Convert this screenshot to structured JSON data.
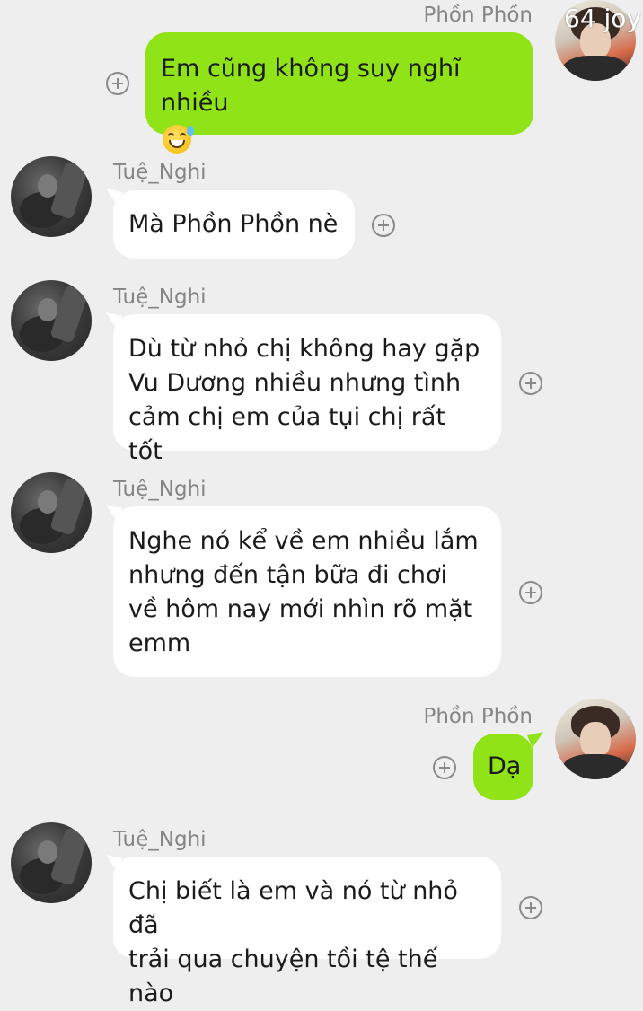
{
  "watermark": "64 joy",
  "messages": [
    {
      "sender": "Phồn Phồn",
      "direction": "outgoing",
      "text": "Em cũng không suy nghĩ nhiều",
      "emoji": "grinning-sweat-emoji"
    },
    {
      "sender": "Tuệ_Nghi",
      "direction": "incoming",
      "text": "Mà Phồn Phồn nè"
    },
    {
      "sender": "Tuệ_Nghi",
      "direction": "incoming",
      "text": "Dù từ nhỏ chị không hay gặp\nVu Dương nhiều nhưng tình\ncảm chị em của tụi chị rất tốt"
    },
    {
      "sender": "Tuệ_Nghi",
      "direction": "incoming",
      "text": "Nghe nó kể về em nhiều lắm\nnhưng đến tận bữa đi chơi\nvề hôm nay mới nhìn rõ mặt\nemm"
    },
    {
      "sender": "Phồn Phồn",
      "direction": "outgoing",
      "text": "Dạ"
    },
    {
      "sender": "Tuệ_Nghi",
      "direction": "incoming",
      "text": "Chị biết là em và nó từ nhỏ đã\ntrải qua chuyện tồi tệ thế nào"
    }
  ],
  "colors": {
    "background": "#eeeeee",
    "incoming_bubble": "#ffffff",
    "outgoing_bubble": "#8fe316",
    "name_text": "#858585"
  }
}
